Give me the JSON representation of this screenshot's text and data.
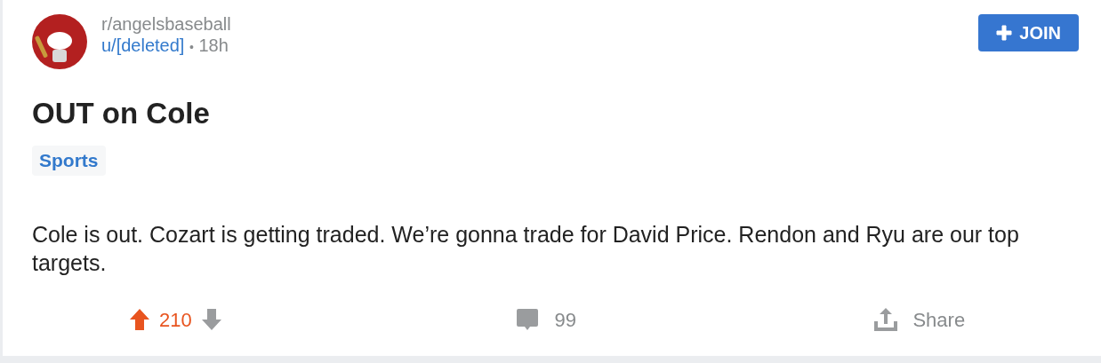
{
  "post": {
    "subreddit": "r/angelsbaseball",
    "author": "u/[deleted]",
    "separator": "•",
    "time": "18h",
    "join_button": {
      "label": "JOIN"
    },
    "title": "OUT on Cole",
    "flair": "Sports",
    "body": "Cole is out. Cozart is getting traded. We’re gonna trade for David Price. Rendon and Ryu are our top targets.",
    "actions": {
      "vote": {
        "score": "210",
        "upvoted": true
      },
      "comments": "99",
      "share": "Share"
    }
  }
}
